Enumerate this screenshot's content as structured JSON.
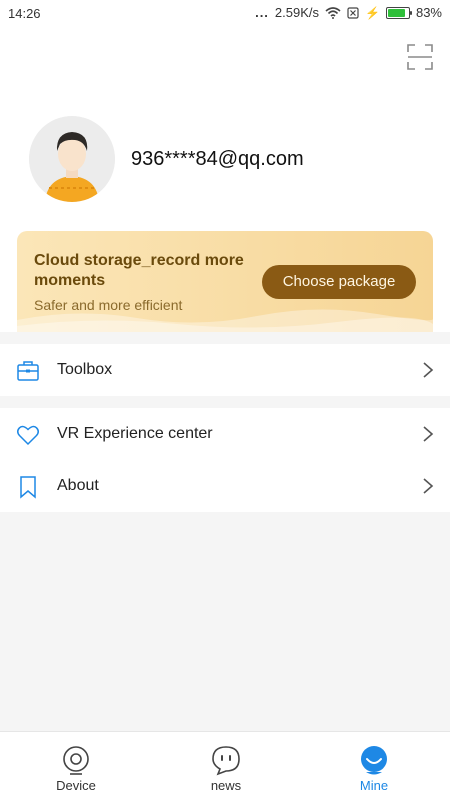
{
  "status_bar": {
    "time": "14:26",
    "dots": "...",
    "network_speed": "2.59K/s",
    "battery_percent": "83%",
    "battery_level": 0.83
  },
  "header": {
    "scan_icon": "scan-icon"
  },
  "profile": {
    "email": "936****84@qq.com",
    "avatar_icon": "user-avatar"
  },
  "promo": {
    "title": "Cloud storage_record more moments",
    "subtitle": "Safer and more efficient",
    "button_label": "Choose package",
    "colors": {
      "bg_start": "#fbe6b8",
      "bg_end": "#f6d595",
      "button": "#8a5a14"
    }
  },
  "menu": {
    "toolbox": {
      "label": "Toolbox",
      "icon": "toolbox-icon"
    },
    "vr": {
      "label": "VR Experience center",
      "icon": "heart-icon"
    },
    "about": {
      "label": "About",
      "icon": "bookmark-icon"
    }
  },
  "bottom_nav": {
    "items": [
      {
        "label": "Device",
        "icon": "camera-icon",
        "active": false
      },
      {
        "label": "news",
        "icon": "chat-icon",
        "active": false
      },
      {
        "label": "Mine",
        "icon": "mine-icon",
        "active": true
      }
    ],
    "accent": "#1e88e5"
  }
}
